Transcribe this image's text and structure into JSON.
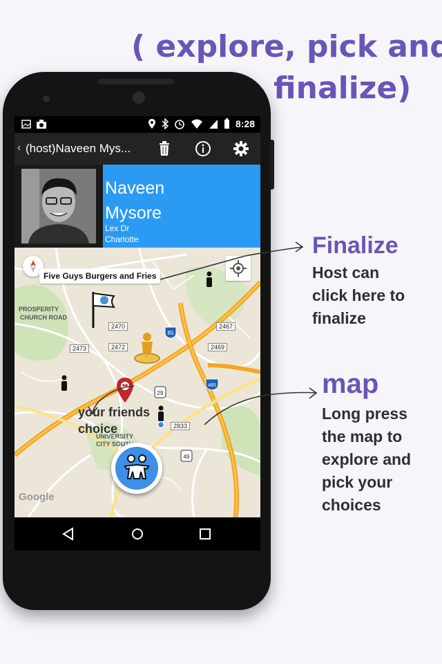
{
  "headline": {
    "line1": "( explore, pick and",
    "line2": "finalize)"
  },
  "status_bar": {
    "time": "8:28"
  },
  "action_bar": {
    "title": "(host)Naveen Mys..."
  },
  "profile": {
    "name_line1": "Naveen",
    "name_line2": "Mysore",
    "address_line1": "Lex Dr",
    "address_line2": "Charlotte"
  },
  "map": {
    "selected_place": "Five Guys Burgers and Fries",
    "friends_choice_line1": "your friends",
    "friends_choice_line2": "choice",
    "area_label_1": "PROSPERITY",
    "area_label_2": "CHURCH ROAD",
    "area_label_3": "UNIVERSITY",
    "area_label_4": "CITY SOUTH",
    "road_numbers": [
      "2470",
      "2467",
      "2473",
      "2472",
      "2469",
      "2833"
    ],
    "highway_85": "85",
    "highway_485": "485",
    "route_29": "29",
    "route_49": "49",
    "copyright": "Google"
  },
  "annotations": {
    "finalize_title": "Finalize",
    "finalize_body": [
      "Host can",
      "click here to",
      "finalize"
    ],
    "map_title": "map",
    "map_body": [
      "Long press",
      "the map to",
      "explore and",
      "pick your",
      "choices"
    ]
  },
  "colors": {
    "accent_purple": "#6a55b6",
    "profile_blue": "#2b9af3",
    "map_background": "#ebe6d8",
    "highway_orange": "#f5a623",
    "fab_blue": "#3d8fe8"
  },
  "icons": [
    "back-chevron-icon",
    "trash-icon",
    "info-icon",
    "settings-gear-icon",
    "compass-icon",
    "my-location-icon",
    "flag-icon",
    "pegman-icon",
    "map-pin-icon",
    "person-marker-icon",
    "friends-icon",
    "nav-back-icon",
    "nav-home-icon",
    "nav-recents-icon"
  ]
}
